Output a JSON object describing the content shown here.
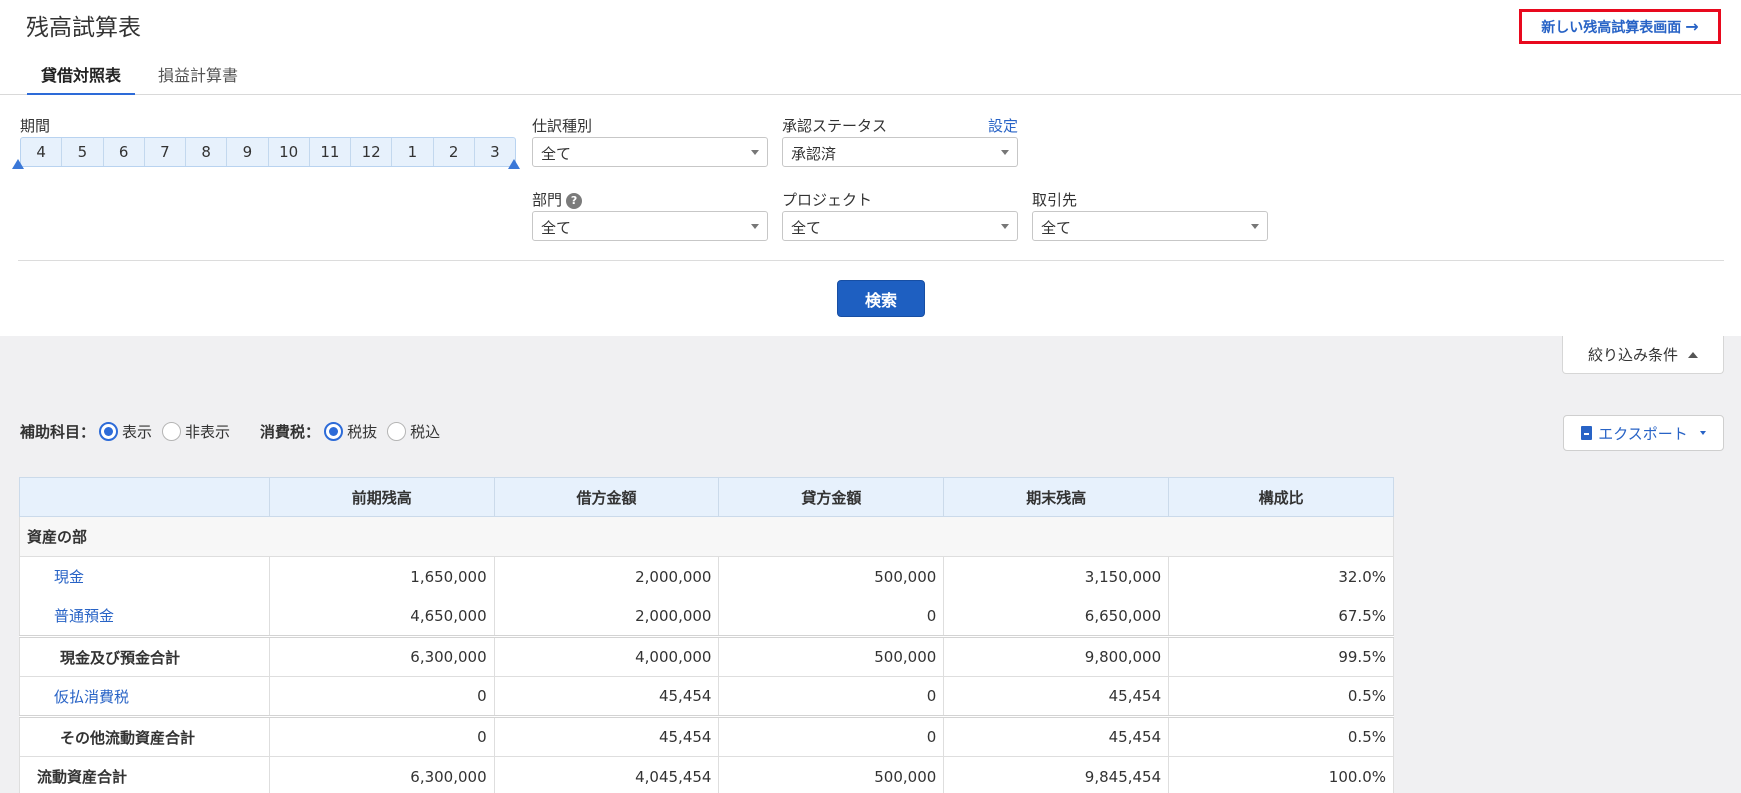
{
  "header": {
    "title": "残高試算表",
    "new_screen_link": "新しい残高試算表画面",
    "tabs": [
      {
        "label": "貸借対照表",
        "active": true
      },
      {
        "label": "損益計算書",
        "active": false
      }
    ]
  },
  "filters": {
    "period": {
      "label": "期間",
      "months": [
        "4",
        "5",
        "6",
        "7",
        "8",
        "9",
        "10",
        "11",
        "12",
        "1",
        "2",
        "3"
      ]
    },
    "journal_type": {
      "label": "仕訳種別",
      "value": "全て"
    },
    "approval_status": {
      "label": "承認ステータス",
      "value": "承認済",
      "settings_link": "設定"
    },
    "department": {
      "label": "部門",
      "value": "全て",
      "help": "?"
    },
    "project": {
      "label": "プロジェクト",
      "value": "全て"
    },
    "client": {
      "label": "取引先",
      "value": "全て"
    },
    "search_button": "検索",
    "collapse_label": "絞り込み条件"
  },
  "options": {
    "sub_account": {
      "label": "補助科目：",
      "show": "表示",
      "hide": "非表示",
      "selected": "表示"
    },
    "tax": {
      "label": "消費税：",
      "exclusive": "税抜",
      "inclusive": "税込",
      "selected": "税抜"
    },
    "export_button": "エクスポート"
  },
  "table": {
    "columns": [
      "",
      "前期残高",
      "借方金額",
      "貸方金額",
      "期末残高",
      "構成比"
    ],
    "section_title": "資産の部",
    "rows": [
      {
        "name": "現金",
        "prev": "1,650,000",
        "debit": "2,000,000",
        "credit": "500,000",
        "end": "3,150,000",
        "ratio": "32.0%"
      },
      {
        "name": "普通預金",
        "prev": "4,650,000",
        "debit": "2,000,000",
        "credit": "0",
        "end": "6,650,000",
        "ratio": "67.5%"
      },
      {
        "name": "現金及び預金合計",
        "prev": "6,300,000",
        "debit": "4,000,000",
        "credit": "500,000",
        "end": "9,800,000",
        "ratio": "99.5%"
      },
      {
        "name": "仮払消費税",
        "prev": "0",
        "debit": "45,454",
        "credit": "0",
        "end": "45,454",
        "ratio": "0.5%"
      },
      {
        "name": "その他流動資産合計",
        "prev": "0",
        "debit": "45,454",
        "credit": "0",
        "end": "45,454",
        "ratio": "0.5%"
      },
      {
        "name": "流動資産合計",
        "prev": "6,300,000",
        "debit": "4,045,454",
        "credit": "500,000",
        "end": "9,845,454",
        "ratio": "100.0%"
      }
    ]
  },
  "colors": {
    "accent": "#2863c6",
    "button": "#1e5fc1",
    "highlight_border": "#e8091e",
    "header_bg": "#e7f1fc"
  }
}
